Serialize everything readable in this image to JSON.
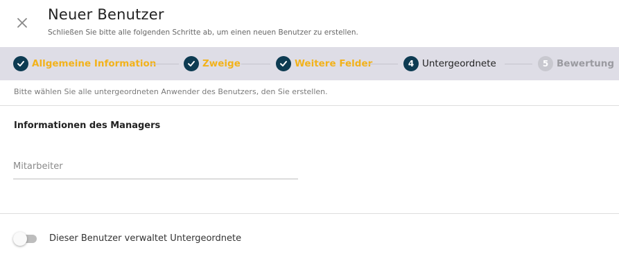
{
  "header": {
    "title": "Neuer Benutzer",
    "subtitle": "Schließen Sie bitte alle folgenden Schritte ab, um einen neuen Benutzer zu erstellen.",
    "close_icon": "close-icon"
  },
  "stepper": {
    "steps": [
      {
        "label": "Allgemeine Information",
        "state": "done",
        "icon": "check-icon"
      },
      {
        "label": "Zweige",
        "state": "done",
        "icon": "check-icon"
      },
      {
        "label": "Weitere Felder",
        "state": "done",
        "icon": "check-icon"
      },
      {
        "label": "Untergeordnete",
        "state": "active",
        "number": "4"
      },
      {
        "label": "Bewertung",
        "state": "pending",
        "number": "5"
      }
    ]
  },
  "main": {
    "hint": "Bitte wählen Sie alle untergeordneten Anwender des Benutzers, den Sie erstellen.",
    "section_title": "Informationen des Managers",
    "employee_field": {
      "placeholder": "Mitarbeiter",
      "value": ""
    },
    "toggle": {
      "label": "Dieser Benutzer verwaltet Untergeordnete",
      "checked": false
    }
  },
  "colors": {
    "done_label": "#f2b21b",
    "step_circle": "#0d3b52",
    "stepper_bg": "#dedde6"
  }
}
